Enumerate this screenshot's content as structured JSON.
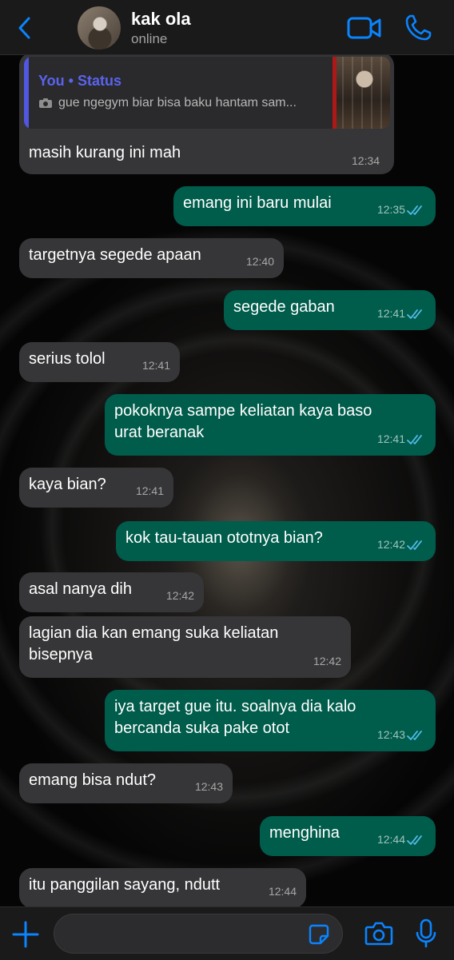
{
  "header": {
    "contact_name": "kak ola",
    "contact_status": "online"
  },
  "quoted_status": {
    "who": "You • Status",
    "text": "gue ngegym biar bisa baku hantam sam..."
  },
  "messages": [
    {
      "dir": "in",
      "text": "masih kurang ini mah",
      "time": "12:34"
    },
    {
      "dir": "out",
      "text": "emang ini baru mulai",
      "time": "12:35",
      "read": true
    },
    {
      "dir": "in",
      "text": "targetnya segede apaan",
      "time": "12:40"
    },
    {
      "dir": "out",
      "text": "segede gaban",
      "time": "12:41",
      "read": true
    },
    {
      "dir": "in",
      "text": "serius tolol",
      "time": "12:41"
    },
    {
      "dir": "out",
      "text": "pokoknya sampe keliatan kaya baso\nurat beranak",
      "time": "12:41",
      "read": true
    },
    {
      "dir": "in",
      "text": "kaya bian?",
      "time": "12:41"
    },
    {
      "dir": "out",
      "text": "kok tau-tauan ototnya bian?",
      "time": "12:42",
      "read": true
    },
    {
      "dir": "in",
      "text": "asal nanya dih",
      "time": "12:42"
    },
    {
      "dir": "in",
      "text": "lagian dia kan emang suka keliatan\nbisepnya",
      "time": "12:42"
    },
    {
      "dir": "out",
      "text": "iya target gue itu. soalnya dia kalo\nbercanda suka pake otot",
      "time": "12:43",
      "read": true
    },
    {
      "dir": "in",
      "text": "emang bisa ndut?",
      "time": "12:43"
    },
    {
      "dir": "out",
      "text": "menghina",
      "time": "12:44",
      "read": true
    },
    {
      "dir": "in",
      "text": "itu panggilan sayang, ndutt",
      "time": "12:44"
    }
  ],
  "composer": {
    "input_value": "",
    "input_placeholder": ""
  },
  "icons": {
    "back": "chevron-left-icon",
    "video": "video-camera-icon",
    "call": "phone-icon",
    "plus": "plus-icon",
    "sticker": "sticker-icon",
    "camera": "camera-icon",
    "mic": "microphone-icon",
    "read": "double-check-icon"
  },
  "colors": {
    "accent": "#0a84ff",
    "incoming_bubble": "#363638",
    "outgoing_bubble": "#005c4b",
    "quote_accent": "#5a63ee",
    "read_ticks": "#53bdeb"
  }
}
